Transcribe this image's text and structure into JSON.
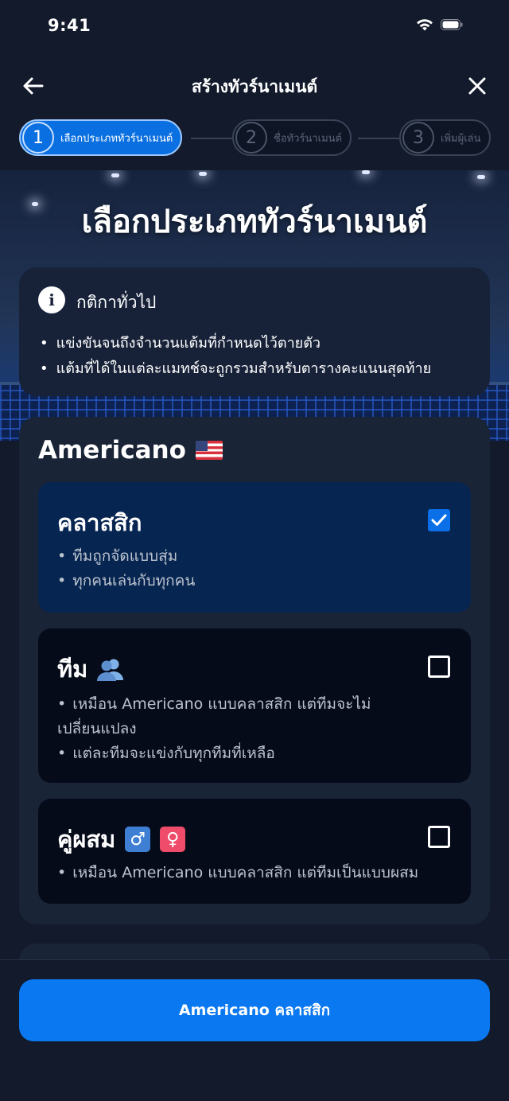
{
  "status_bar": {
    "time": "9:41"
  },
  "nav": {
    "title": "สร้างทัวร์นาเมนต์",
    "back_icon": "arrow-left-icon",
    "close_icon": "close-icon"
  },
  "stepper": {
    "steps": [
      {
        "number": "1",
        "label": "เลือกประเภททัวร์นาเมนต์",
        "active": true
      },
      {
        "number": "2",
        "label": "ชื่อทัวร์นาเมนต์",
        "active": false
      },
      {
        "number": "3",
        "label": "เพิ่มผู้เล่น",
        "active": false
      }
    ]
  },
  "page": {
    "heading": "เลือกประเภททัวร์นาเมนต์"
  },
  "rules": {
    "title": "กติกาทั่วไป",
    "icon": "info-icon",
    "items": [
      "แข่งขันจนถึงจำนวนแต้มที่กำหนดไว้ตายตัว",
      "แต้มที่ได้ในแต่ละแมทช์จะถูกรวมสำหรับตารางคะแนนสุดท้าย"
    ]
  },
  "format": {
    "title": "Americano",
    "flag": "us-flag-icon",
    "options": [
      {
        "title": "คลาสสิก",
        "checked": true,
        "items": [
          "ทีมถูกจัดแบบสุ่ม",
          "ทุกคนเล่นกับทุกคน"
        ]
      },
      {
        "title": "ทีม",
        "icon": "team-people-icon",
        "checked": false,
        "items": [
          "เหมือน Americano แบบคลาสสิก แต่ทีมจะไม่เปลี่ยนแปลง",
          "แต่ละทีมจะแข่งกับทุกทีมที่เหลือ"
        ]
      },
      {
        "title": "คู่ผสม",
        "male_symbol": "♂",
        "female_symbol": "♀",
        "checked": false,
        "items": [
          "เหมือน Americano แบบคลาสสิก แต่ทีมเป็นแบบผสม"
        ]
      }
    ]
  },
  "cta": {
    "label": "Americano คลาสสิก"
  },
  "colors": {
    "accent": "#0a78f0",
    "background": "#121a2c",
    "card": "#1a2437",
    "selected": "#062550"
  }
}
